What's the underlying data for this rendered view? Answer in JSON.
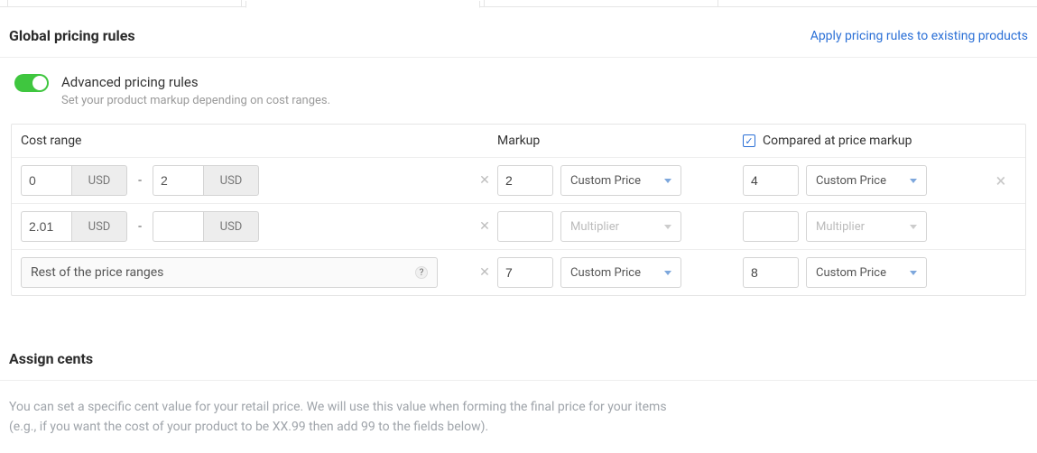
{
  "global": {
    "section_title": "Global pricing rules",
    "apply_link": "Apply pricing rules to existing products"
  },
  "advanced": {
    "title": "Advanced pricing rules",
    "subtitle": "Set your product markup depending on cost ranges.",
    "enabled": true
  },
  "table": {
    "headers": {
      "cost_range": "Cost range",
      "markup": "Markup",
      "compared": "Compared at price markup"
    },
    "currency": "USD",
    "compared_checked": true,
    "rest_label": "Rest of the price ranges",
    "select_options": {
      "custom_price": "Custom Price",
      "multiplier": "Multiplier"
    },
    "rows": [
      {
        "from": "0",
        "to": "2",
        "markup_value": "2",
        "markup_type": "Custom Price",
        "compared_value": "4",
        "compared_type": "Custom Price",
        "clearable": true,
        "removable": true,
        "disabled": false
      },
      {
        "from": "2.01",
        "to": "",
        "markup_value": "",
        "markup_type": "Multiplier",
        "compared_value": "",
        "compared_type": "Multiplier",
        "clearable": true,
        "removable": false,
        "disabled": true
      }
    ],
    "rest_row": {
      "markup_value": "7",
      "markup_type": "Custom Price",
      "compared_value": "8",
      "compared_type": "Custom Price"
    }
  },
  "assign_cents": {
    "title": "Assign cents",
    "desc_line1": "You can set a specific cent value for your retail price. We will use this value when forming the final price for your items",
    "desc_line2": "(e.g., if you want the cost of your product to be XX.99 then add 99 to the fields below)."
  }
}
